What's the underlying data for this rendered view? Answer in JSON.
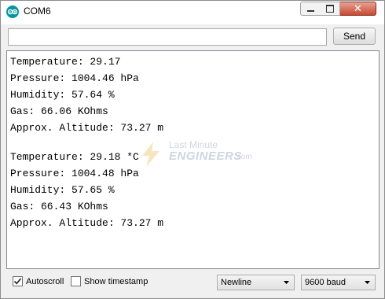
{
  "window": {
    "title": "COM6",
    "controls": {
      "minimize": "minimize",
      "maximize": "maximize",
      "close": "close"
    },
    "close_glyph": "✕"
  },
  "input": {
    "value": "",
    "placeholder": ""
  },
  "send_button": {
    "label": "Send"
  },
  "serial_output": {
    "block1": [
      "Temperature: 29.17",
      "Pressure: 1004.46 hPa",
      "Humidity: 57.64 %",
      "Gas: 66.06 KOhms",
      "Approx. Altitude: 73.27 m"
    ],
    "block2": [
      "Temperature: 29.18 *C",
      "Pressure: 1004.48 hPa",
      "Humidity: 57.65 %",
      "Gas: 66.43 KOhms",
      "Approx. Altitude: 73.27 m"
    ]
  },
  "watermark": {
    "top": "Last Minute",
    "bottom": "ENGINEERS",
    "suffix": ".com"
  },
  "footer": {
    "autoscroll": {
      "label": "Autoscroll",
      "checked": true
    },
    "timestamp": {
      "label": "Show timestamp",
      "checked": false
    },
    "line_ending": {
      "selected": "Newline"
    },
    "baud_rate": {
      "selected": "9600 baud"
    }
  },
  "colors": {
    "accent": "#00979c",
    "watermark": "#6a7fa8",
    "close": "#c74a32"
  },
  "icons": {
    "app": "arduino-logo-icon",
    "check": "checkmark-icon",
    "dropdown": "chevron-down-icon"
  }
}
